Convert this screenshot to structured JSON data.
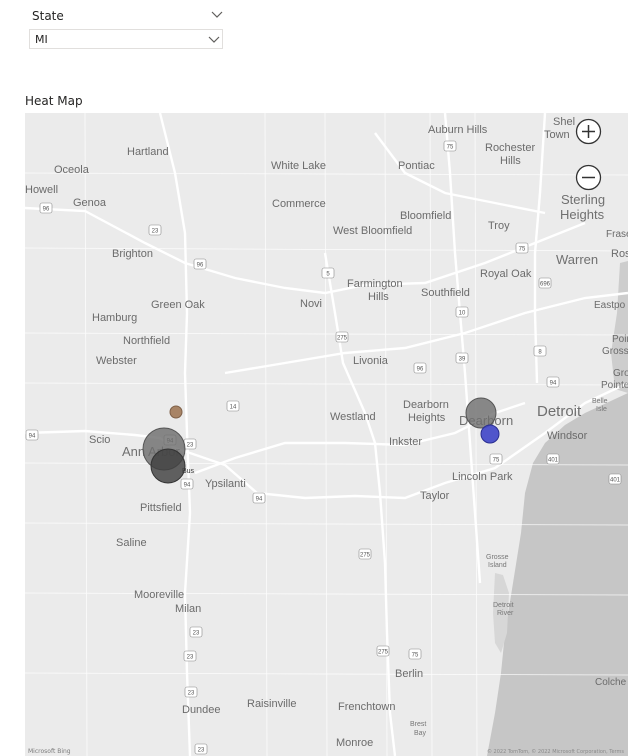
{
  "filter": {
    "label": "State",
    "selected": "MI"
  },
  "visual": {
    "title": "Heat Map"
  },
  "map": {
    "cities": [
      {
        "name": "Auburn Hills",
        "size": "city"
      },
      {
        "name": "Shel",
        "size": "city"
      },
      {
        "name": "Town",
        "size": "city"
      },
      {
        "name": "Hartland",
        "size": "city"
      },
      {
        "name": "Rochester",
        "size": "city"
      },
      {
        "name": "Hills",
        "size": "city"
      },
      {
        "name": "White Lake",
        "size": "city"
      },
      {
        "name": "Pontiac",
        "size": "city"
      },
      {
        "name": "Oceola",
        "size": "city"
      },
      {
        "name": "Howell",
        "size": "city"
      },
      {
        "name": "Sterling",
        "size": "mid"
      },
      {
        "name": "Heights",
        "size": "mid"
      },
      {
        "name": "Commerce",
        "size": "city"
      },
      {
        "name": "Bloomfield",
        "size": "city"
      },
      {
        "name": "Genoa",
        "size": "city"
      },
      {
        "name": "West Bloomfield",
        "size": "city"
      },
      {
        "name": "Troy",
        "size": "city"
      },
      {
        "name": "Frase",
        "size": "sm"
      },
      {
        "name": "Brighton",
        "size": "city"
      },
      {
        "name": "Warren",
        "size": "mid"
      },
      {
        "name": "Ros",
        "size": "city"
      },
      {
        "name": "Royal Oak",
        "size": "city"
      },
      {
        "name": "Farmington",
        "size": "city"
      },
      {
        "name": "Hills",
        "size": "city"
      },
      {
        "name": "Southfield",
        "size": "city"
      },
      {
        "name": "Green Oak",
        "size": "city"
      },
      {
        "name": "Novi",
        "size": "city"
      },
      {
        "name": "Eastpo",
        "size": "sm"
      },
      {
        "name": "Hamburg",
        "size": "city"
      },
      {
        "name": "Northfield",
        "size": "city"
      },
      {
        "name": "Poin",
        "size": "sm"
      },
      {
        "name": "Gross",
        "size": "sm"
      },
      {
        "name": "Livonia",
        "size": "city"
      },
      {
        "name": "Webster",
        "size": "city"
      },
      {
        "name": "Gro",
        "size": "sm"
      },
      {
        "name": "Pointe",
        "size": "sm"
      },
      {
        "name": "Dearborn",
        "size": "city"
      },
      {
        "name": "Heights",
        "size": "city"
      },
      {
        "name": "Westland",
        "size": "city"
      },
      {
        "name": "Detroit",
        "size": "big"
      },
      {
        "name": "Belle",
        "size": "tiny"
      },
      {
        "name": "Isle",
        "size": "tiny"
      },
      {
        "name": "Dearborn",
        "size": "mid"
      },
      {
        "name": "Windsor",
        "size": "city"
      },
      {
        "name": "Scio",
        "size": "city"
      },
      {
        "name": "Ann Arbor",
        "size": "mid"
      },
      {
        "name": "Inkster",
        "size": "city"
      },
      {
        "name": "Lincoln Park",
        "size": "city"
      },
      {
        "name": "Ypsilanti",
        "size": "city"
      },
      {
        "name": "Taylor",
        "size": "city"
      },
      {
        "name": "Pittsfield",
        "size": "city"
      },
      {
        "name": "Saline",
        "size": "city"
      },
      {
        "name": "Grosse",
        "size": "tiny"
      },
      {
        "name": "Island",
        "size": "tiny"
      },
      {
        "name": "Mooreville",
        "size": "city"
      },
      {
        "name": "Milan",
        "size": "city"
      },
      {
        "name": "Detroit",
        "size": "tiny"
      },
      {
        "name": "River",
        "size": "tiny"
      },
      {
        "name": "Berlin",
        "size": "city"
      },
      {
        "name": "Colche",
        "size": "sm"
      },
      {
        "name": "Raisinville",
        "size": "city"
      },
      {
        "name": "Dundee",
        "size": "city"
      },
      {
        "name": "Frenchtown",
        "size": "city"
      },
      {
        "name": "Brest",
        "size": "tiny"
      },
      {
        "name": "Bay",
        "size": "tiny"
      },
      {
        "name": "Monroe",
        "size": "city"
      },
      {
        "name": "Bus",
        "size": "tiny"
      }
    ],
    "shields": [
      "75",
      "96",
      "23",
      "96",
      "5",
      "275",
      "75",
      "696",
      "10",
      "8",
      "39",
      "94",
      "96",
      "14",
      "94",
      "23",
      "94",
      "94",
      "275",
      "94",
      "75",
      "401",
      "401",
      "23",
      "23",
      "23",
      "275",
      "75",
      "23"
    ],
    "zoom_in_label": "+",
    "zoom_out_label": "−",
    "attribution": "Microsoft Bing",
    "copyright": "© 2022 TomTom, © 2022 Microsoft Corporation, Terms",
    "bubble_colors": {
      "gray": "#6e6e6e",
      "dark": "#3f3f3f",
      "brown": "#a88466",
      "blue": "#3f45c8"
    }
  }
}
